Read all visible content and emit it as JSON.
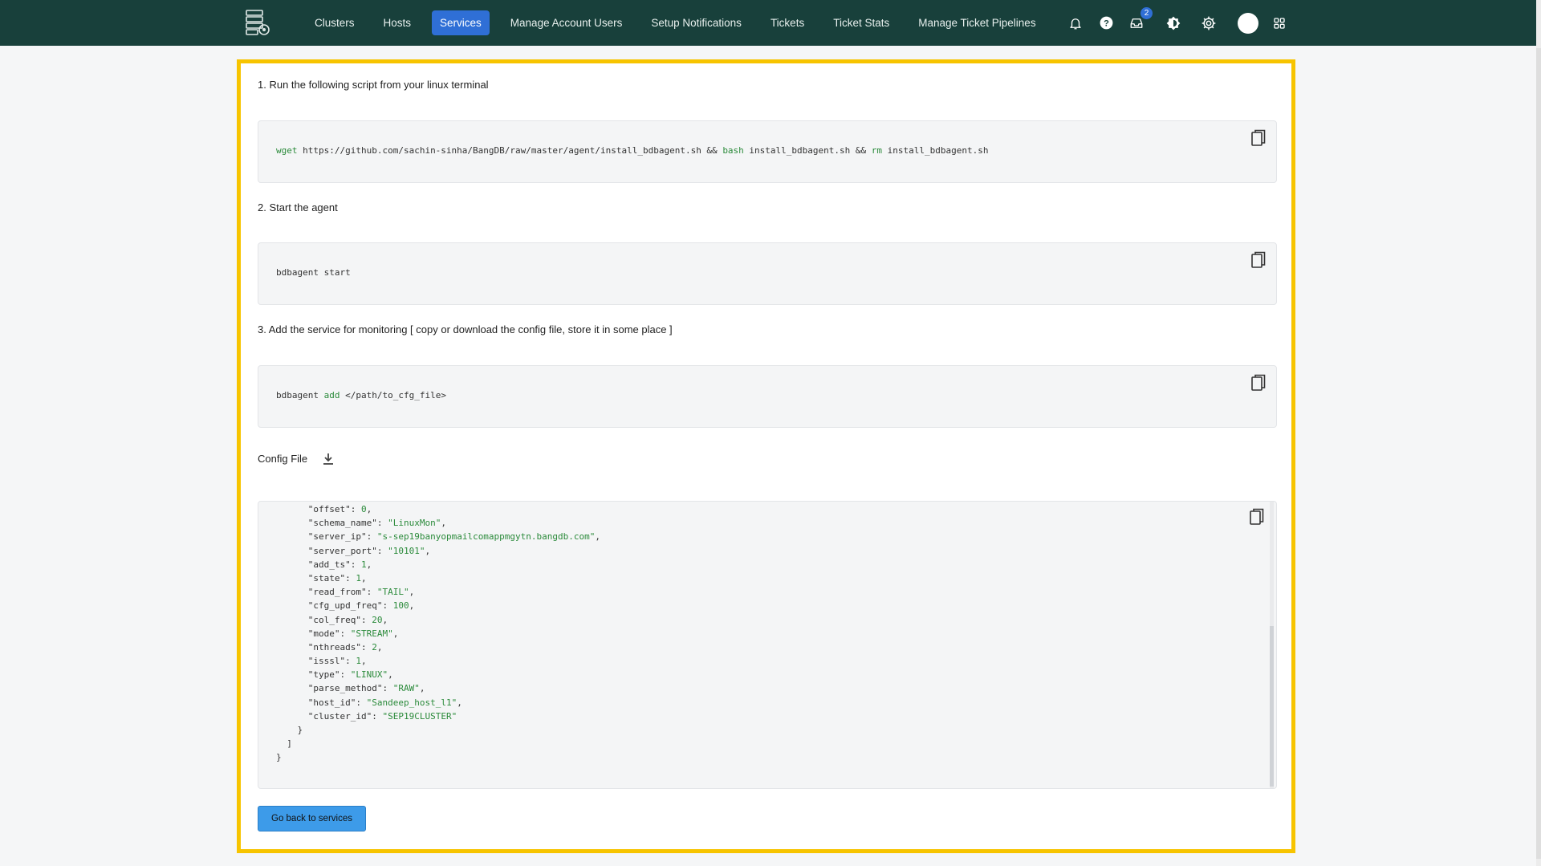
{
  "nav": {
    "items": [
      "Clusters",
      "Hosts",
      "Services",
      "Manage Account Users",
      "Setup Notifications",
      "Tickets",
      "Ticket Stats",
      "Manage Ticket Pipelines"
    ],
    "active": "Services",
    "icons": [
      "bell-icon",
      "help-icon",
      "inbox-icon",
      "theme-icon",
      "gear-icon",
      "avatar",
      "apps-grid-icon"
    ],
    "inbox_badge": "2"
  },
  "steps": {
    "step1": "1. Run the following script from your linux terminal",
    "step2": "2. Start the agent",
    "step3": "3. Add the service for monitoring [ copy or download the config file, store it in some place ]"
  },
  "code": {
    "install": {
      "kw1": "wget",
      "url": " https://github.com/sachin-sinha/BangDB/raw/master/agent/install_bdbagent.sh && ",
      "kw2": "bash",
      "mid": " install_bdbagent.sh && ",
      "kw3": "rm",
      "end": " install_bdbagent.sh"
    },
    "start": "bdbagent start",
    "add": {
      "cmd": "bdbagent ",
      "kw": "add",
      "arg": " </path/to_cfg_file>"
    }
  },
  "config": {
    "label": "Config File",
    "lines": [
      {
        "indent": "      ",
        "key": "\"offset\"",
        "val": "0",
        "type": "num",
        "comma": ","
      },
      {
        "indent": "      ",
        "key": "\"schema_name\"",
        "val": "\"LinuxMon\"",
        "type": "str",
        "comma": ","
      },
      {
        "indent": "      ",
        "key": "\"server_ip\"",
        "val": "\"s-sep19banyopmailcomappmgytn.bangdb.com\"",
        "type": "str",
        "comma": ","
      },
      {
        "indent": "      ",
        "key": "\"server_port\"",
        "val": "\"10101\"",
        "type": "str",
        "comma": ","
      },
      {
        "indent": "      ",
        "key": "\"add_ts\"",
        "val": "1",
        "type": "num",
        "comma": ","
      },
      {
        "indent": "      ",
        "key": "\"state\"",
        "val": "1",
        "type": "num",
        "comma": ","
      },
      {
        "indent": "      ",
        "key": "\"read_from\"",
        "val": "\"TAIL\"",
        "type": "str",
        "comma": ","
      },
      {
        "indent": "      ",
        "key": "\"cfg_upd_freq\"",
        "val": "100",
        "type": "num",
        "comma": ","
      },
      {
        "indent": "      ",
        "key": "\"col_freq\"",
        "val": "20",
        "type": "num",
        "comma": ","
      },
      {
        "indent": "      ",
        "key": "\"mode\"",
        "val": "\"STREAM\"",
        "type": "str",
        "comma": ","
      },
      {
        "indent": "      ",
        "key": "\"nthreads\"",
        "val": "2",
        "type": "num",
        "comma": ","
      },
      {
        "indent": "      ",
        "key": "\"isssl\"",
        "val": "1",
        "type": "num",
        "comma": ","
      },
      {
        "indent": "      ",
        "key": "\"type\"",
        "val": "\"LINUX\"",
        "type": "str",
        "comma": ","
      },
      {
        "indent": "      ",
        "key": "\"parse_method\"",
        "val": "\"RAW\"",
        "type": "str",
        "comma": ","
      },
      {
        "indent": "      ",
        "key": "\"host_id\"",
        "val": "\"Sandeep_host_l1\"",
        "type": "str",
        "comma": ","
      },
      {
        "indent": "      ",
        "key": "\"cluster_id\"",
        "val": "\"SEP19CLUSTER\"",
        "type": "str",
        "comma": ""
      },
      {
        "indent": "    ",
        "key": "}",
        "val": "",
        "type": "plain",
        "comma": ""
      },
      {
        "indent": "  ",
        "key": "]",
        "val": "",
        "type": "plain",
        "comma": ""
      },
      {
        "indent": "",
        "key": "}",
        "val": "",
        "type": "plain",
        "comma": ""
      }
    ]
  },
  "buttons": {
    "back": "Go back to services"
  },
  "colors": {
    "topbar": "#18403b",
    "active_nav": "#2f6fd6",
    "highlight": "#f7c400",
    "code_keyword": "#2a8a3a",
    "back_button": "#3d9be9"
  }
}
